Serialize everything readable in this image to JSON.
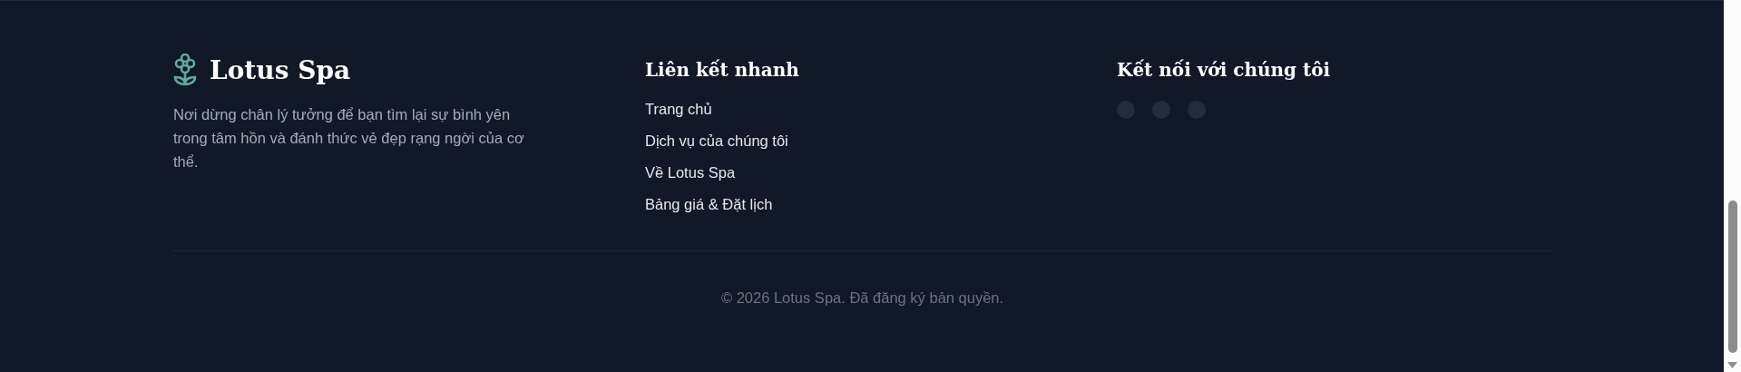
{
  "brand": {
    "name": "Lotus Spa",
    "description": "Nơi dừng chân lý tưởng để bạn tìm lại sự bình yên trong tâm hồn và đánh thức vẻ đẹp rạng ngời của cơ thể."
  },
  "quick_links": {
    "heading": "Liên kết nhanh",
    "items": [
      "Trang chủ",
      "Dịch vụ của chúng tôi",
      "Về Lotus Spa",
      "Bảng giá & Đặt lịch"
    ]
  },
  "connect": {
    "heading": "Kết nối với chúng tôi",
    "socials": [
      {
        "kind": "social"
      },
      {
        "kind": "social"
      },
      {
        "kind": "social"
      }
    ]
  },
  "copyright": "© 2026 Lotus Spa. Đã đăng ký bản quyền."
}
